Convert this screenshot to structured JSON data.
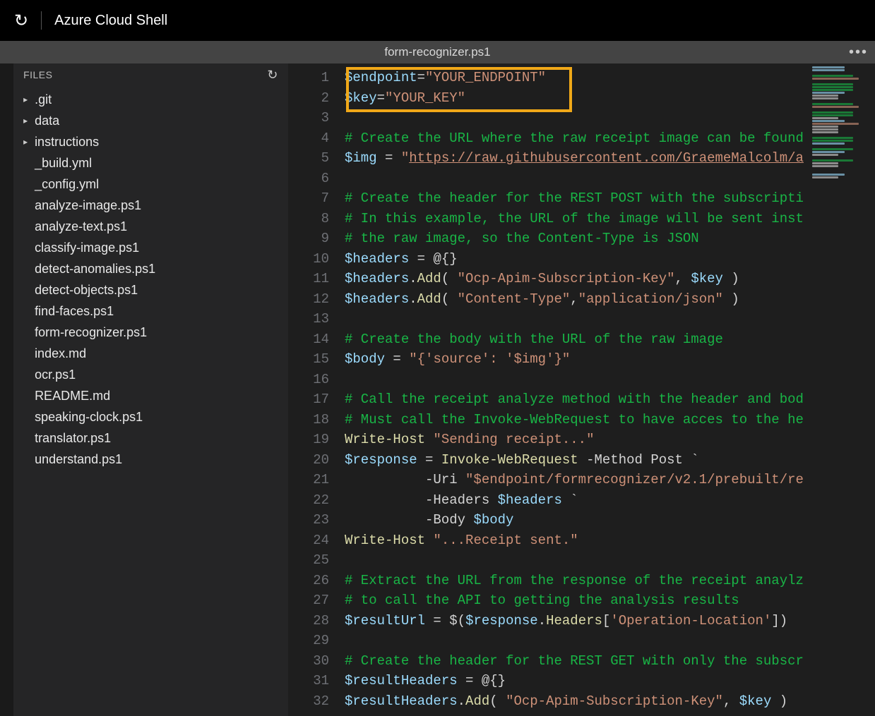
{
  "titlebar": {
    "title": "Azure Cloud Shell"
  },
  "tab": {
    "filename": "form-recognizer.ps1"
  },
  "sidebar": {
    "header": "FILES",
    "items": [
      {
        "label": ".git",
        "type": "folder"
      },
      {
        "label": "data",
        "type": "folder"
      },
      {
        "label": "instructions",
        "type": "folder"
      },
      {
        "label": "_build.yml",
        "type": "file"
      },
      {
        "label": "_config.yml",
        "type": "file"
      },
      {
        "label": "analyze-image.ps1",
        "type": "file"
      },
      {
        "label": "analyze-text.ps1",
        "type": "file"
      },
      {
        "label": "classify-image.ps1",
        "type": "file"
      },
      {
        "label": "detect-anomalies.ps1",
        "type": "file"
      },
      {
        "label": "detect-objects.ps1",
        "type": "file"
      },
      {
        "label": "find-faces.ps1",
        "type": "file"
      },
      {
        "label": "form-recognizer.ps1",
        "type": "file"
      },
      {
        "label": "index.md",
        "type": "file"
      },
      {
        "label": "ocr.ps1",
        "type": "file"
      },
      {
        "label": "README.md",
        "type": "file"
      },
      {
        "label": "speaking-clock.ps1",
        "type": "file"
      },
      {
        "label": "translator.ps1",
        "type": "file"
      },
      {
        "label": "understand.ps1",
        "type": "file"
      }
    ]
  },
  "code": {
    "lines": [
      [
        {
          "t": "var",
          "s": "$endpoint"
        },
        {
          "t": "op",
          "s": "="
        },
        {
          "t": "str",
          "s": "\"YOUR_ENDPOINT\""
        }
      ],
      [
        {
          "t": "var",
          "s": "$key"
        },
        {
          "t": "op",
          "s": "="
        },
        {
          "t": "str",
          "s": "\"YOUR_KEY\""
        }
      ],
      [],
      [
        {
          "t": "cmt",
          "s": "# Create the URL where the raw receipt image can be found"
        }
      ],
      [
        {
          "t": "var",
          "s": "$img"
        },
        {
          "t": "op",
          "s": " = "
        },
        {
          "t": "str",
          "s": "\""
        },
        {
          "t": "link",
          "s": "https://raw.githubusercontent.com/GraemeMalcolm/a"
        }
      ],
      [],
      [
        {
          "t": "cmt",
          "s": "# Create the header for the REST POST with the subscripti"
        }
      ],
      [
        {
          "t": "cmt",
          "s": "# In this example, the URL of the image will be sent inst"
        }
      ],
      [
        {
          "t": "cmt",
          "s": "# the raw image, so the Content-Type is JSON"
        }
      ],
      [
        {
          "t": "var",
          "s": "$headers"
        },
        {
          "t": "op",
          "s": " = "
        },
        {
          "t": "op",
          "s": "@{}"
        }
      ],
      [
        {
          "t": "var",
          "s": "$headers"
        },
        {
          "t": "plain",
          "s": "."
        },
        {
          "t": "fn",
          "s": "Add"
        },
        {
          "t": "plain",
          "s": "( "
        },
        {
          "t": "str",
          "s": "\"Ocp-Apim-Subscription-Key\""
        },
        {
          "t": "plain",
          "s": ", "
        },
        {
          "t": "var",
          "s": "$key"
        },
        {
          "t": "plain",
          "s": " )"
        }
      ],
      [
        {
          "t": "var",
          "s": "$headers"
        },
        {
          "t": "plain",
          "s": "."
        },
        {
          "t": "fn",
          "s": "Add"
        },
        {
          "t": "plain",
          "s": "( "
        },
        {
          "t": "str",
          "s": "\"Content-Type\""
        },
        {
          "t": "plain",
          "s": ","
        },
        {
          "t": "str",
          "s": "\"application/json\""
        },
        {
          "t": "plain",
          "s": " )"
        }
      ],
      [],
      [
        {
          "t": "cmt",
          "s": "# Create the body with the URL of the raw image"
        }
      ],
      [
        {
          "t": "var",
          "s": "$body"
        },
        {
          "t": "op",
          "s": " = "
        },
        {
          "t": "str",
          "s": "\"{'source': '$img'}\""
        }
      ],
      [],
      [
        {
          "t": "cmt",
          "s": "# Call the receipt analyze method with the header and bod"
        }
      ],
      [
        {
          "t": "cmt",
          "s": "# Must call the Invoke-WebRequest to have acces to the he"
        }
      ],
      [
        {
          "t": "fn",
          "s": "Write-Host"
        },
        {
          "t": "plain",
          "s": " "
        },
        {
          "t": "str",
          "s": "\"Sending receipt...\""
        }
      ],
      [
        {
          "t": "var",
          "s": "$response"
        },
        {
          "t": "op",
          "s": " = "
        },
        {
          "t": "fn",
          "s": "Invoke-WebRequest"
        },
        {
          "t": "plain",
          "s": " "
        },
        {
          "t": "plain",
          "s": "-Method"
        },
        {
          "t": "plain",
          "s": " Post `"
        }
      ],
      [
        {
          "t": "plain",
          "s": "          -Uri "
        },
        {
          "t": "str",
          "s": "\"$endpoint/formrecognizer/v2.1/prebuilt/re"
        }
      ],
      [
        {
          "t": "plain",
          "s": "          -Headers "
        },
        {
          "t": "var",
          "s": "$headers"
        },
        {
          "t": "plain",
          "s": " `"
        }
      ],
      [
        {
          "t": "plain",
          "s": "          -Body "
        },
        {
          "t": "var",
          "s": "$body"
        }
      ],
      [
        {
          "t": "fn",
          "s": "Write-Host"
        },
        {
          "t": "plain",
          "s": " "
        },
        {
          "t": "str",
          "s": "\"...Receipt sent.\""
        }
      ],
      [],
      [
        {
          "t": "cmt",
          "s": "# Extract the URL from the response of the receipt anaylz"
        }
      ],
      [
        {
          "t": "cmt",
          "s": "# to call the API to getting the analysis results"
        }
      ],
      [
        {
          "t": "var",
          "s": "$resultUrl"
        },
        {
          "t": "op",
          "s": " = "
        },
        {
          "t": "plain",
          "s": "$("
        },
        {
          "t": "var",
          "s": "$response"
        },
        {
          "t": "plain",
          "s": "."
        },
        {
          "t": "fn",
          "s": "Headers"
        },
        {
          "t": "plain",
          "s": "["
        },
        {
          "t": "str",
          "s": "'Operation-Location'"
        },
        {
          "t": "plain",
          "s": "])"
        }
      ],
      [],
      [
        {
          "t": "cmt",
          "s": "# Create the header for the REST GET with only the subscr"
        }
      ],
      [
        {
          "t": "var",
          "s": "$resultHeaders"
        },
        {
          "t": "op",
          "s": " = "
        },
        {
          "t": "op",
          "s": "@{}"
        }
      ],
      [
        {
          "t": "var",
          "s": "$resultHeaders"
        },
        {
          "t": "plain",
          "s": "."
        },
        {
          "t": "fn",
          "s": "Add"
        },
        {
          "t": "plain",
          "s": "( "
        },
        {
          "t": "str",
          "s": "\"Ocp-Apim-Subscription-Key\""
        },
        {
          "t": "plain",
          "s": ", "
        },
        {
          "t": "var",
          "s": "$key"
        },
        {
          "t": "plain",
          "s": " )"
        }
      ]
    ]
  }
}
